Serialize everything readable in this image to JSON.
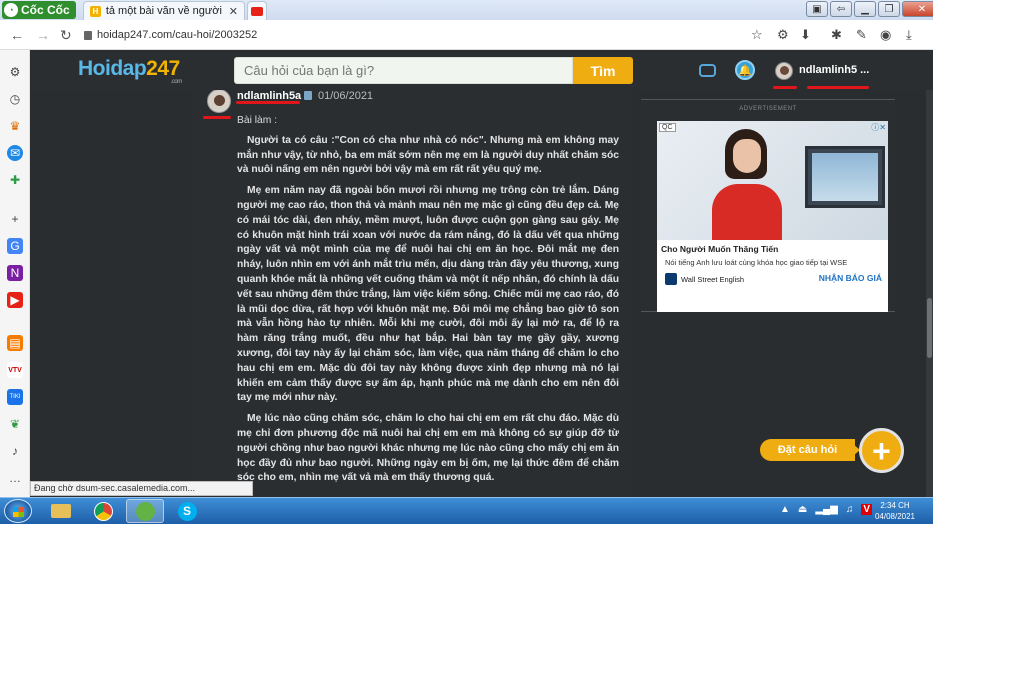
{
  "browser": {
    "brand": "Cốc Cốc",
    "tabs": [
      {
        "label": "tả một bài văn về người mẹ"
      },
      {
        "label": ""
      }
    ],
    "url": "hoidap247.com/cau-hoi/2003252",
    "status_url": "Đang chờ dsum-sec.casalemedia.com..."
  },
  "site": {
    "logo_text": "Hoidap",
    "logo_num": "247",
    "logo_sub": ".com",
    "search_placeholder": "Câu hỏi của bạn là gì?",
    "search_button": "Tìm",
    "username": "ndlamlinh5 ..."
  },
  "post": {
    "author": "ndlamlinh5a",
    "date": "01/06/2021",
    "intro": "Bài làm :",
    "paragraphs": [
      "Người ta có câu :\"Con có cha như nhà có nóc\". Nhưng mà em không may mắn như vậy, từ nhỏ, ba em mất sớm nên mẹ em là người duy nhất chăm sóc và nuôi nấng em nên người bởi vậy mà em rất rất yêu quý mẹ.",
      "Mẹ em năm nay đã ngoài bốn mươi rồi nhưng mẹ trông còn trẻ lắm. Dáng người mẹ cao ráo, thon thả và mảnh mau nên mẹ mặc gì cũng đều đẹp cả. Mẹ có mái tóc dài, đen nháy, mềm mượt, luôn được cuộn gọn gàng sau gáy. Mẹ có khuôn mặt hình trái xoan với nước da rám nắng, đó là dấu vết qua những ngày vất vả một mình của mẹ để nuôi hai chị em ăn học. Đôi mắt mẹ đen nháy, luôn nhìn em với ánh mắt trìu mến, dịu dàng tràn đầy yêu thương, xung quanh khóe mắt là những vết cuống thâm và một ít nếp nhăn, đó chính là dấu vết sau những đêm thức trắng, làm việc kiếm sống. Chiếc mũi mẹ cao ráo, đó là mũi dọc dừa, rất hợp với khuôn mặt mẹ. Đôi môi mẹ chẳng bao giờ tô son mà vẫn hồng hào tự nhiên. Mỗi khi mẹ cười, đôi môi ấy lại mở ra, để lộ ra hàm răng trắng muốt, đều như hạt bắp. Hai bàn tay mẹ gầy gầy, xương xương, đôi tay này ấy lại chăm sóc, làm việc, qua năm tháng để chăm lo cho hau chị em em. Mặc dù đôi tay này không được xinh đẹp nhưng mà nó lại khiến em cảm thấy được sự ấm áp, hạnh phúc mà mẹ dành cho em nên đôi tay mẹ mới như này.",
      "Mẹ lúc nào cũng chăm sóc, chăm lo cho hai chị em em rất chu đáo. Mặc dù mẹ chỉ đơn phương độc mã nuôi hai chị em em mà không có sự giúp đỡ từ người chồng như bao người khác nhưng mẹ lúc nào cũng cho mấy chị em ăn học đầy đủ như bao người. Những ngày em bị ốm, mẹ lại thức đêm để chăm sóc cho em, nhìn mẹ vất vả mà em thấy thương quá."
    ]
  },
  "ad": {
    "label": "ADVERTISEMENT",
    "qc": "QC",
    "title": "Cho Người Muốn Thăng Tiến",
    "desc": "Nói tiếng Anh lưu loát cùng khóa học giao tiếp tại WSE",
    "brand": "Wall Street English",
    "cta": "NHẬN BÁO GIÁ"
  },
  "fab": {
    "label": "Đặt câu hỏi",
    "icon": "+"
  },
  "taskbar": {
    "time": "2:34 CH",
    "date": "04/08/2021"
  }
}
